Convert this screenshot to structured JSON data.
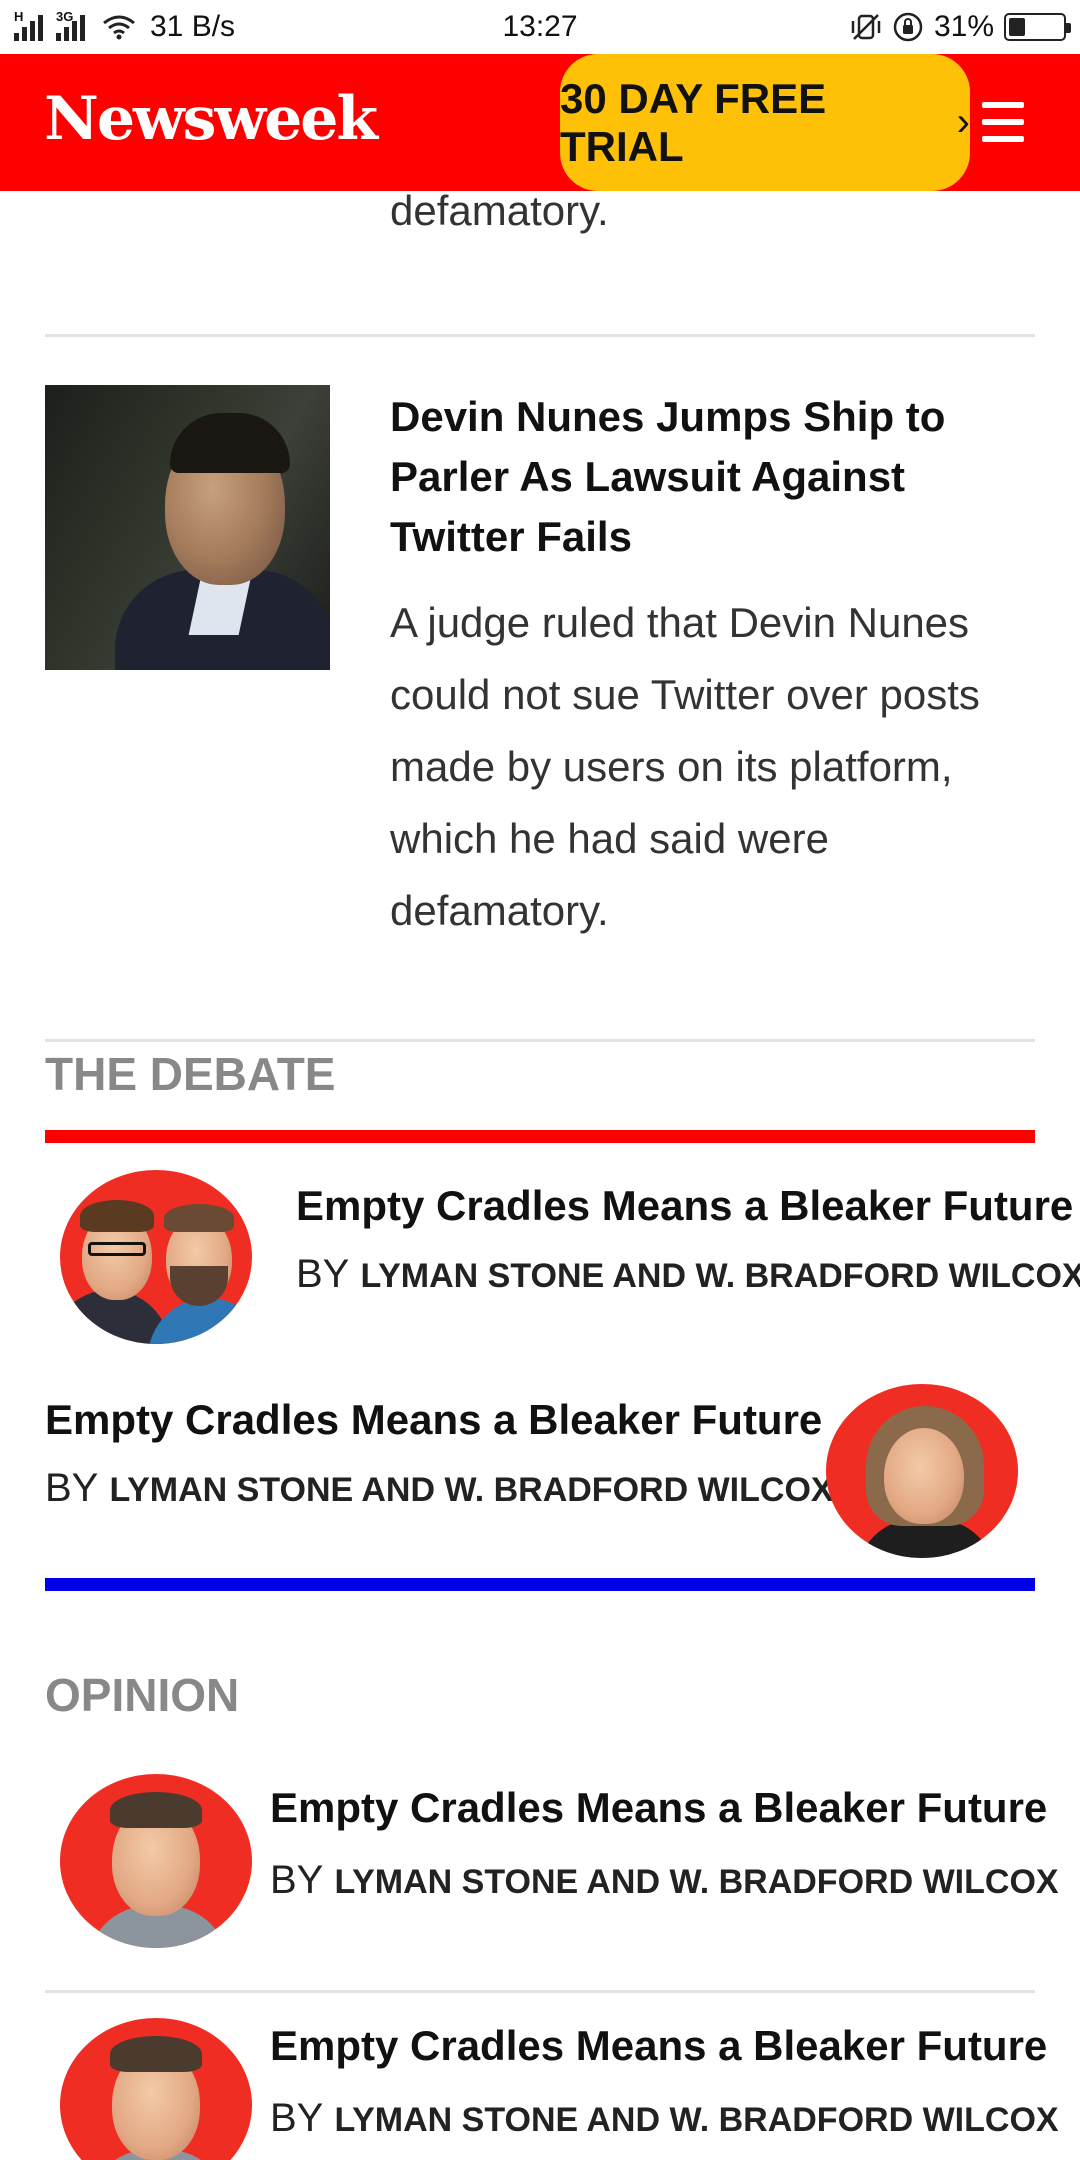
{
  "status_bar": {
    "net_speed": "31 B/s",
    "time": "13:27",
    "battery_percent": "31%",
    "battery_level": 0.31,
    "network_tags": [
      "H",
      "3G"
    ]
  },
  "header": {
    "logo": "Newsweek",
    "trial_button": "30 DAY FREE TRIAL",
    "trial_chevron": "›"
  },
  "previous_article_tail": "defamatory.",
  "article": {
    "title": "Devin Nunes Jumps Ship to Parler As Lawsuit Against Twitter Fails",
    "description": "A judge ruled that Devin Nunes could not sue Twitter over posts made by users on its platform, which he had said were defamatory."
  },
  "debate": {
    "section_title": "THE DEBATE",
    "top_color": "#ff0000",
    "bottom_color": "#0000e6",
    "items": [
      {
        "title": "Empty Cradles Means a Bleaker Future",
        "by": "BY",
        "authors": "LYMAN STONE AND W. BRADFORD WILCOX"
      },
      {
        "title": "Empty Cradles Means a Bleaker Future",
        "by": "BY",
        "authors": "LYMAN STONE AND W. BRADFORD WILCOX"
      }
    ]
  },
  "opinion": {
    "section_title": "OPINION",
    "items": [
      {
        "title": "Empty Cradles Means a Bleaker Future",
        "by": "BY",
        "authors": "LYMAN STONE AND W. BRADFORD WILCOX"
      },
      {
        "title": "Empty Cradles Means a Bleaker Future",
        "by": "BY",
        "authors": "LYMAN STONE AND W. BRADFORD WILCOX"
      }
    ]
  },
  "colors": {
    "brand_red": "#ff0000",
    "trial_yellow": "#ffc107",
    "avatar_red": "#ef2d23",
    "section_gray": "#888888"
  }
}
